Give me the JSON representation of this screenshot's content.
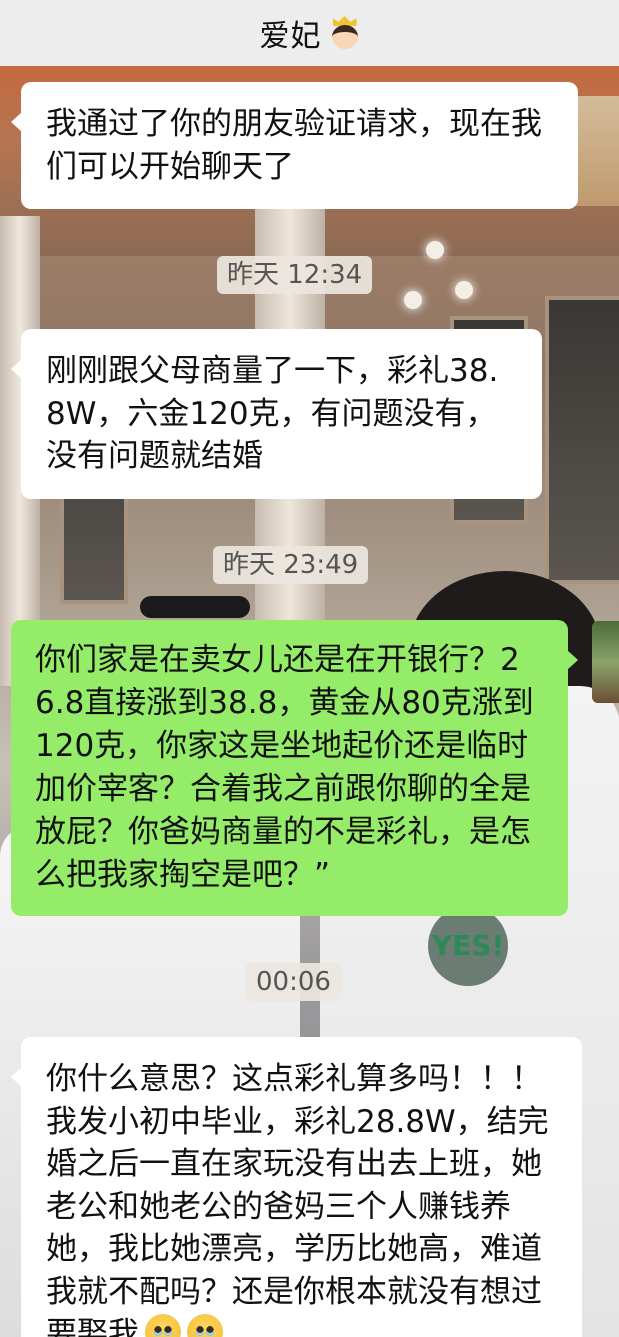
{
  "header": {
    "title": "爱妃"
  },
  "messages": [
    {
      "side": "in",
      "text": "我通过了你的朋友验证请求，现在我们可以开始聊天了"
    },
    {
      "type": "time",
      "text": "昨天 12:34"
    },
    {
      "side": "in",
      "text": "刚刚跟父母商量了一下，彩礼38.8W，六金120克，有问题没有，没有问题就结婚"
    },
    {
      "type": "time",
      "text": "昨天 23:49"
    },
    {
      "side": "out",
      "text": "你们家是在卖女儿还是在开银行？26.8直接涨到38.8，黄金从80克涨到120克，你家这是坐地起价还是临时加价宰客？合着我之前跟你聊的全是放屁？你爸妈商量的不是彩礼，是怎么把我家掏空是吧？”"
    },
    {
      "type": "time",
      "text": "00:06"
    },
    {
      "side": "in",
      "text": "你什么意思？这点彩礼算多吗！！！我发小初中毕业，彩礼28.8W，结完婚之后一直在家玩没有出去上班，她老公和她老公的爸妈三个人赚钱养她，我比她漂亮，学历比她高，难道我就不配吗？还是你根本就没有想过要娶我"
    }
  ],
  "background_photo_text": "YES!",
  "colors": {
    "header_bg": "#ededed",
    "incoming_bubble": "#ffffff",
    "outgoing_bubble": "#95ec69"
  },
  "icons": [
    "crowned-face-emoji-icon",
    "pleading-face-emoji-icon"
  ]
}
